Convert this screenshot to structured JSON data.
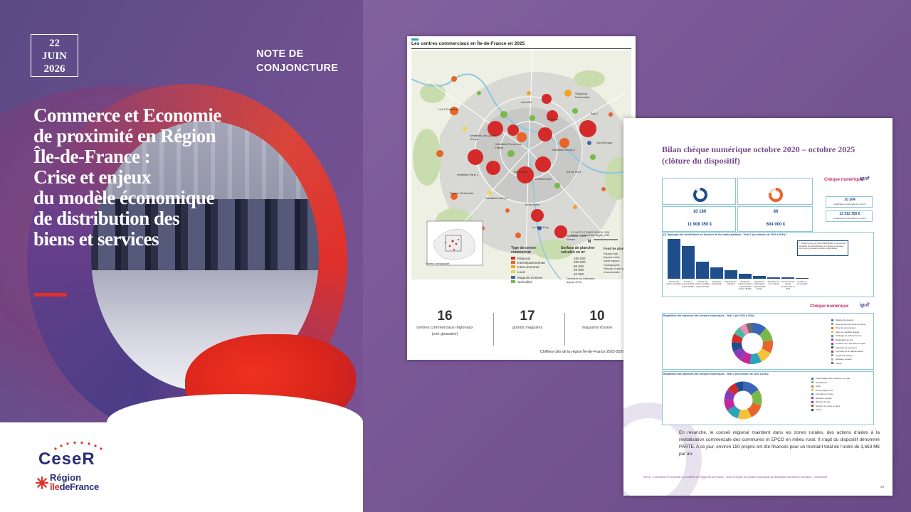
{
  "cover": {
    "date_day": "22",
    "date_month": "JUIN",
    "date_year": "2026",
    "note_line1": "NOTE DE",
    "note_line2": "CONJONCTURE",
    "title_lines": [
      "Commerce et Economie",
      "de proximité en Région",
      "Île-de-France :",
      "Crise et enjeux",
      "du modèle économique",
      "de distribution des",
      "biens et services"
    ],
    "logo_ceser": "CeseR",
    "logo_region_1": "Région",
    "logo_region_2a": "île",
    "logo_region_2b": "deFrance"
  },
  "map_page": {
    "title": "Les centres commerciaux en Île-de-France en 2025",
    "places": [
      "Aéroville",
      "O'Parinor",
      "Westfield Les Quatre Temps",
      "Westfield Forum des Halles",
      "Westfield Rosny 2",
      "Val d'Europe",
      "Westfield Parly 2",
      "Espace St Quentin",
      "Westfield Vélizy 2",
      "Créteil Soleil",
      "Belle Épine",
      "Le Spot Évry",
      "Westfield Carré Sénart",
      "Les 3 Fontaines",
      "Bay 2",
      "Italie Deux",
      "Art de Vivre",
      "Shopping Promenade"
    ],
    "legend_type_title": "Type de centre commercial",
    "legend_types": [
      "Régional",
      "Interdépartemental",
      "Intercommunal",
      "Local",
      "Magasin d'usines",
      "Spécialisé"
    ],
    "legend_type_colors": [
      "#d42a2a",
      "#e8642a",
      "#f2a22a",
      "#f2d24a",
      "#3a66b8",
      "#7ab84a"
    ],
    "legend_surface_title": "Surface de plancher calculée en m²",
    "legend_surfaces": [
      "165 000",
      "100 000",
      "50 000",
      "25 000",
      "10 000"
    ],
    "legend_open": "Ouverture ou extension depuis 2018",
    "legend_fond_title": "Fond de plan",
    "legend_fond": [
      "Espace bâti",
      "Espace boisé",
      "Autre espace",
      "Hydrographie",
      "Réseau routier principal et secondaire"
    ],
    "inset_label": "Secteur cartographié",
    "source": "© L'INSTITUT PARIS REGION, 2025 Source : L'Institut Paris Region, 2025",
    "stats": [
      {
        "value": "16",
        "label_1": "centres commerciaux régionaux",
        "label_2": "(voir glossaire)"
      },
      {
        "value": "17",
        "label_1": "grands magasins",
        "label_2": ""
      },
      {
        "value": "10",
        "label_1": "magasins d'usine",
        "label_2": ""
      }
    ],
    "footer": "Chiffres-clés de la région Île-de-France 2025-2026",
    "page": "33"
  },
  "bilan_page": {
    "title": "Bilan chèque numérique octobre 2020 – octobre 2025 (clôture du dispositif)",
    "cheque_label": "Chèque numérique",
    "cheque_label_2": "Chèque numérique",
    "igrif": "igrif",
    "k1": "10 180",
    "k2": "86",
    "k3": "11 908 350 €",
    "k4": "604 000 €",
    "k5": "10 264",
    "k6": "12 512 350 €",
    "k5_label": "bénéficiaires au total (volet 1 et volet 2)",
    "k6_label": "de dépenses au total (volet 1 et volet 2)",
    "bar_chart_title": "(1) Typologie des bénéficiaires en fonction de leur statut juridique - Volet 1 (en nombre, de 2022 à 2024) *",
    "bar_values": [
      4900,
      4000,
      2100,
      1400,
      1050,
      600,
      340,
      210,
      150,
      90
    ],
    "bar_labels": [
      "Société par actions simplifiée",
      "Société à responsabilité limitée (SARL)",
      "Société par actions simplifiée unipersonnelle",
      "Entreprise individuelle",
      "Entrepreneur individuel",
      "Entreprise unipersonnelle à responsabilité limitée (EURL)",
      "Entreprise individuelle à responsabilité limitée",
      "Entreprise en nom collectif",
      "Autre personne morale immatriculée au RCS",
      "Société en commandite"
    ],
    "bar_note": "* Il aurait conçu un cumul bénéficiaire à mesure de la réalité des bénéficiaires du chèque numérique, soit une ou plusieurs entités prétendantes",
    "donut1_title": "Répartition des dépenses des chèques numériques - Volet 1 (de 2023 à 2024)",
    "donut1_legend": [
      "Matériel de gestion",
      "Abonnement de ventes en ligne",
      "Prise de commandes",
      "Aide à la visibilité digitale",
      "Stratégie de référencement",
      "Réalisation de site",
      "Création d'un site web de vente",
      "Solutions de paiement",
      "Formation à la transformation",
      "Logiciel de caisse",
      "Réseaux sociaux",
      "Autres"
    ],
    "donut1_colors": [
      "#3a66b8",
      "#7ab84a",
      "#e8642a",
      "#f2c23a",
      "#2aa5b8",
      "#c02a9a",
      "#8a3ab8",
      "#1f4e8c",
      "#d42a2a",
      "#4ab8a0",
      "#f08ab8",
      "#6a6a6a"
    ],
    "donut2_title": "Répartition des dépenses des chèques numériques - Volet 2 (en nombre, de 2023 à 2024)",
    "donut2_legend": [
      "Projet digital sans présence en ligne",
      "Prestataires",
      "Audit",
      "Accompagnement",
      "Formation en ligne",
      "Réseaux sociaux",
      "Refonte de site",
      "Solution de vente en ligne",
      "Autres"
    ],
    "donut2_colors": [
      "#3a66b8",
      "#7ab84a",
      "#e8642a",
      "#f2c23a",
      "#2aa5b8",
      "#c02a9a",
      "#8a3ab8",
      "#d42a2a",
      "#1f4e8c"
    ],
    "body": "En revanche, le conseil régional maintient dans les zones rurales, des actions d'aides à la revitalisation commerciale des communes et EPCO en milieu rural. Il s'agit du dispositif dénommé PARTE. A ce jour, environ 150 projets ont été financés pour un montant total de l'ordre de 3,663 M€ par an.",
    "footer": "NOTE – Commerce et Economie de proximité en Région Île-de-France : Crise et enjeux du modèle économique de distribution des biens et services – 22/06/2026",
    "page": "29"
  }
}
